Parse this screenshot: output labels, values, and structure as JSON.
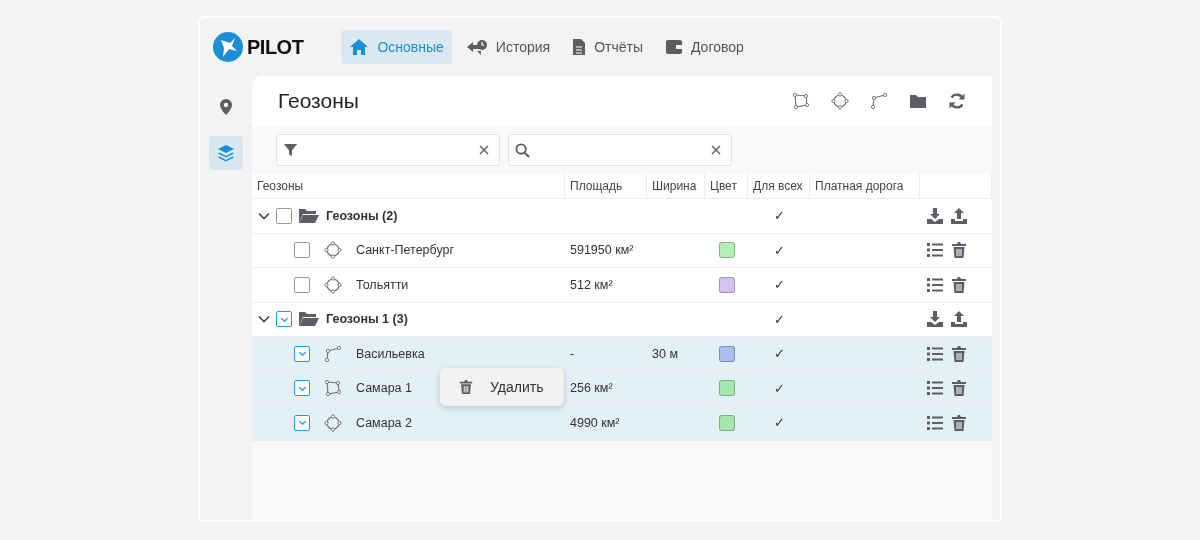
{
  "logo": {
    "text": "PILOT"
  },
  "nav": [
    {
      "label": "Основные",
      "selected": true
    },
    {
      "label": "История",
      "selected": false
    },
    {
      "label": "Отчёты",
      "selected": false
    },
    {
      "label": "Договор",
      "selected": false
    }
  ],
  "sidebar": {
    "items": [
      {
        "selected": false
      },
      {
        "selected": true
      }
    ]
  },
  "page": {
    "title": "Геозоны",
    "tools": [
      {
        "kind": "polygon"
      },
      {
        "kind": "circle"
      },
      {
        "kind": "line"
      },
      {
        "kind": "folder"
      },
      {
        "kind": "refresh"
      }
    ]
  },
  "table": {
    "columns": [
      "Геозоны",
      "Площадь",
      "Ширина",
      "Цвет",
      "Для всех",
      "Платная дорога"
    ],
    "groups": [
      {
        "name": "Геозоны (2)",
        "expanded": true,
        "checked": false,
        "for_all": "✓",
        "children": [
          {
            "kind": "circle",
            "name": "Санкт-Петербург",
            "area": "591950 км²",
            "color": "#b6efb6",
            "for_all": "✓",
            "checked": false
          },
          {
            "kind": "circle",
            "name": "Тольятти",
            "area": "512 км²",
            "color": "#d3c4f2",
            "for_all": "✓",
            "checked": false
          }
        ]
      },
      {
        "name": "Геозоны 1 (3)",
        "expanded": true,
        "checked": true,
        "for_all": "✓",
        "children": [
          {
            "kind": "line",
            "name": "Васильевка",
            "area": "-",
            "width": "30 м",
            "color": "#aabff0",
            "for_all": "✓",
            "checked": true
          },
          {
            "kind": "polygon",
            "name": "Самара 1",
            "area": "256 км²",
            "color": "#a6e8ac",
            "for_all": "✓",
            "checked": true
          },
          {
            "kind": "circle",
            "name": "Самара 2",
            "area": "4990 км²",
            "color": "#a6e8ac",
            "for_all": "✓",
            "checked": true
          }
        ]
      }
    ]
  },
  "context_menu": {
    "label": "Удалить"
  }
}
